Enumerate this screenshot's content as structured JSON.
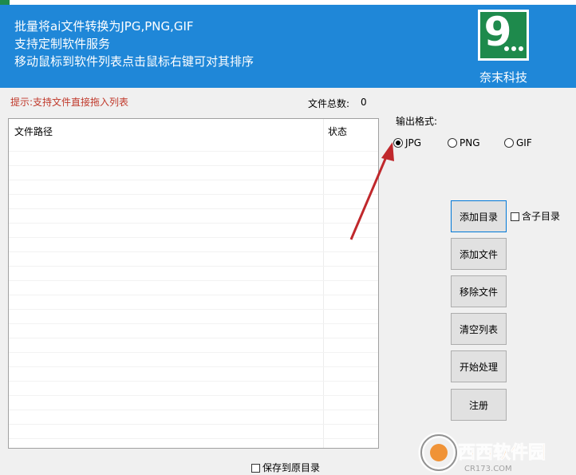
{
  "header": {
    "lines": [
      "批量将ai文件转换为JPG,PNG,GIF",
      "支持定制软件服务",
      "移动鼠标到软件列表点击鼠标右键可对其排序"
    ],
    "company": "奈末科技",
    "logo_text": "9",
    "bg_color": "#1f87d8",
    "logo_color": "#1e8a4c"
  },
  "hint": "提示:支持文件直接拖入列表",
  "file_count": {
    "label": "文件总数:",
    "value": "0"
  },
  "file_list": {
    "columns": [
      "文件路径",
      "状态"
    ],
    "rows": []
  },
  "output_format": {
    "label": "输出格式:",
    "options": [
      "JPG",
      "PNG",
      "GIF"
    ],
    "selected": "JPG"
  },
  "buttons": {
    "add_dir": "添加目录",
    "add_file": "添加文件",
    "remove_file": "移除文件",
    "clear_list": "清空列表",
    "start": "开始处理",
    "register": "注册"
  },
  "checkboxes": {
    "include_subdir": {
      "label": "含子目录",
      "checked": false
    },
    "save_to_original": {
      "label": "保存到原目录",
      "checked": false
    }
  },
  "watermark": {
    "brand": "西西软件园",
    "url": "CR173.COM"
  }
}
